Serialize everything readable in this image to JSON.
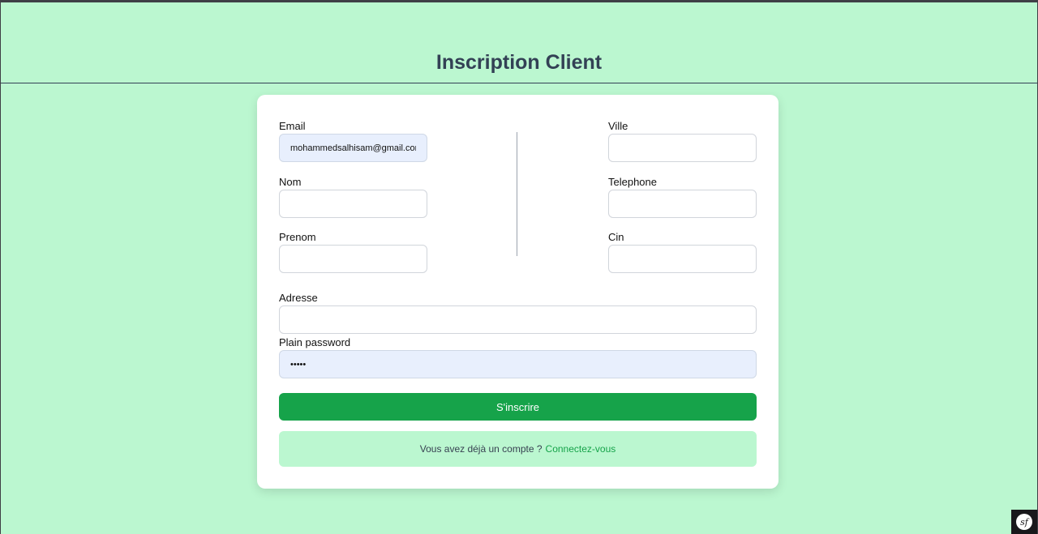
{
  "page": {
    "title": "Inscription Client"
  },
  "form": {
    "email": {
      "label": "Email",
      "value": "mohammedsalhisam@gmail.com"
    },
    "nom": {
      "label": "Nom",
      "value": ""
    },
    "prenom": {
      "label": "Prenom",
      "value": ""
    },
    "ville": {
      "label": "Ville",
      "value": ""
    },
    "telephone": {
      "label": "Telephone",
      "value": ""
    },
    "cin": {
      "label": "Cin",
      "value": ""
    },
    "adresse": {
      "label": "Adresse",
      "value": ""
    },
    "password": {
      "label": "Plain password",
      "value": "•••••"
    },
    "submit_label": "S'inscrire"
  },
  "login_prompt": {
    "text": "Vous avez déjà un compte ?",
    "link": "Connectez-vous"
  },
  "debug_toolbar": {
    "icon": "symfony-icon",
    "glyph": "sf"
  },
  "colors": {
    "background": "#bbf7d0",
    "accent": "#16a34a",
    "title": "#334155"
  }
}
